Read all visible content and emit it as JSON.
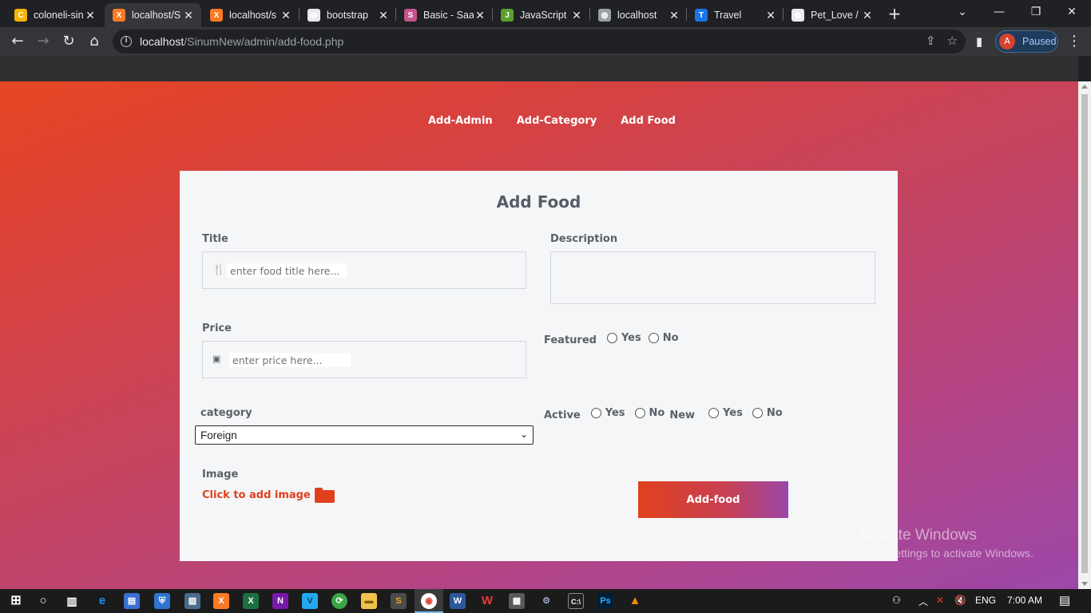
{
  "browser": {
    "tabs": [
      {
        "title": "coloneli-sin",
        "icon": "globe-yellow-icon",
        "color": "#f4b400",
        "glyph": "C"
      },
      {
        "title": "localhost/S",
        "icon": "xampp-icon",
        "color": "#fb7a24",
        "glyph": "X",
        "active": true
      },
      {
        "title": "localhost/s",
        "icon": "xampp-icon",
        "color": "#fb7a24",
        "glyph": "X"
      },
      {
        "title": "bootstrap",
        "icon": "globe-icon",
        "color": "#e8eaed",
        "glyph": "◍"
      },
      {
        "title": "Basic - Saa",
        "icon": "sass-icon",
        "color": "#c6538c",
        "glyph": "S"
      },
      {
        "title": "JavaScript",
        "icon": "js-icon",
        "color": "#5aa02c",
        "glyph": "J"
      },
      {
        "title": "localhost",
        "icon": "globe-icon",
        "color": "#9aa0a6",
        "glyph": "◍"
      },
      {
        "title": "Travel",
        "icon": "travel-icon",
        "color": "#1a73e8",
        "glyph": "T"
      },
      {
        "title": "Pet_Love /",
        "icon": "globe-icon",
        "color": "#e8eaed",
        "glyph": "◍"
      }
    ],
    "url_host": "localhost",
    "url_path": "/SinumNew/admin/add-food.php",
    "profile_initial": "A",
    "profile_status": "Paused"
  },
  "nav": {
    "items": [
      "Add-Admin",
      "Add-Category",
      "Add Food"
    ]
  },
  "form": {
    "title": "Add Food",
    "title_label": "Title",
    "title_placeholder": "enter food title here...",
    "description_label": "Description",
    "price_label": "Price",
    "price_placeholder": "enter price here...",
    "featured_label": "Featured",
    "yes": "Yes",
    "no": "No",
    "category_label": "category",
    "category_selected": "Foreign",
    "active_label": "Active",
    "new_label": "New",
    "image_label": "Image",
    "image_link": "Click to add image",
    "submit_label": "Add-food"
  },
  "watermark": {
    "line1": "Activate Windows",
    "line2": "Go to Settings to activate Windows."
  },
  "taskbar": {
    "language": "ENG",
    "time": "7:00 AM"
  },
  "colors": {
    "accent_orange": "#e0401e",
    "accent_purple": "#9b47a9",
    "card_bg": "#f5f6f8"
  }
}
